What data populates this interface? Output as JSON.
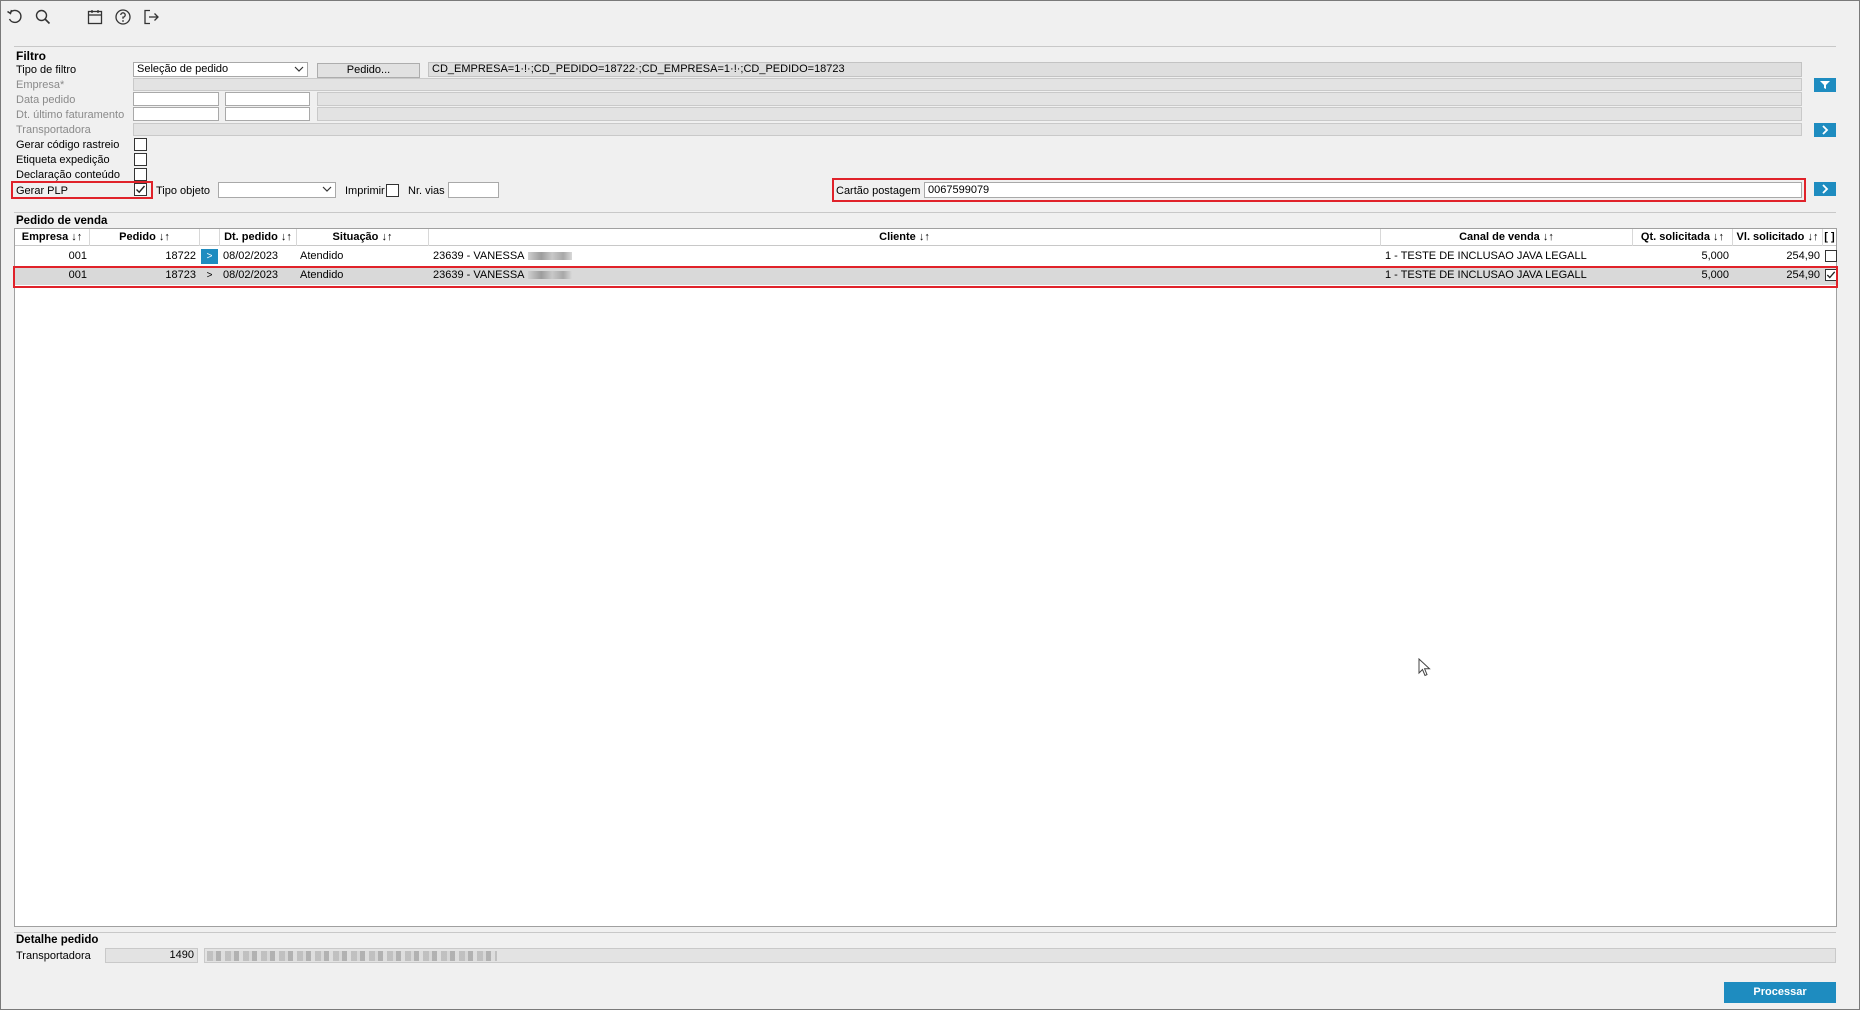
{
  "toolbar": {
    "icons": [
      "undo-icon",
      "search-icon",
      "calendar-icon",
      "help-icon",
      "logout-icon"
    ]
  },
  "filter": {
    "section_title": "Filtro",
    "tipo_filtro_label": "Tipo de filtro",
    "tipo_filtro_value": "Seleção de pedido",
    "pedido_button": "Pedido...",
    "pedido_selection": "CD_EMPRESA=1·!·;CD_PEDIDO=18722·;CD_EMPRESA=1·!·;CD_PEDIDO=18723",
    "empresa_label": "Empresa*",
    "data_pedido_label": "Data pedido",
    "dt_ultimo_fat_label": "Dt. último faturamento",
    "transportadora_label": "Transportadora",
    "gerar_codigo_rastreio_label": "Gerar código rastreio",
    "gerar_codigo_rastreio_checked": false,
    "etiqueta_expedicao_label": "Etiqueta expedição",
    "etiqueta_expedicao_checked": false,
    "declaracao_conteudo_label": "Declaração conteúdo",
    "declaracao_conteudo_checked": false,
    "gerar_plp_label": "Gerar PLP",
    "gerar_plp_checked": true,
    "tipo_objeto_label": "Tipo objeto",
    "tipo_objeto_value": "",
    "imprimir_label": "Imprimir",
    "imprimir_checked": false,
    "nr_vias_label": "Nr. vias",
    "nr_vias_value": "",
    "cartao_postagem_label": "Cartão postagem",
    "cartao_postagem_value": "0067599079"
  },
  "orders": {
    "section_title": "Pedido de venda",
    "columns": {
      "empresa": "Empresa ↓↑",
      "pedido": "Pedido ↓↑",
      "dt_pedido": "Dt. pedido ↓↑",
      "situacao": "Situação ↓↑",
      "cliente": "Cliente ↓↑",
      "canal": "Canal de venda ↓↑",
      "qt": "Qt. solicitada ↓↑",
      "vl": "Vl. solicitado ↓↑",
      "sel": "[ ]"
    },
    "rows": [
      {
        "empresa": "001",
        "pedido": "18722",
        "arrow": ">",
        "dt_pedido": "08/02/2023",
        "situacao": "Atendido",
        "cliente": "23639 - VANESSA",
        "canal": "1 - TESTE DE INCLUSAO JAVA LEGALL",
        "qt": "5,000",
        "vl": "254,90",
        "checked": false,
        "selected": false
      },
      {
        "empresa": "001",
        "pedido": "18723",
        "arrow": ">",
        "dt_pedido": "08/02/2023",
        "situacao": "Atendido",
        "cliente": "23639 - VANESSA",
        "canal": "1 - TESTE DE INCLUSAO JAVA LEGALL",
        "qt": "5,000",
        "vl": "254,90",
        "checked": true,
        "selected": true
      }
    ]
  },
  "detail": {
    "section_title": "Detalhe pedido",
    "transportadora_label": "Transportadora",
    "transportadora_code": "1490"
  },
  "actions": {
    "processar": "Processar"
  },
  "colors": {
    "accent": "#1e8cc0",
    "highlight": "#e0222a"
  }
}
